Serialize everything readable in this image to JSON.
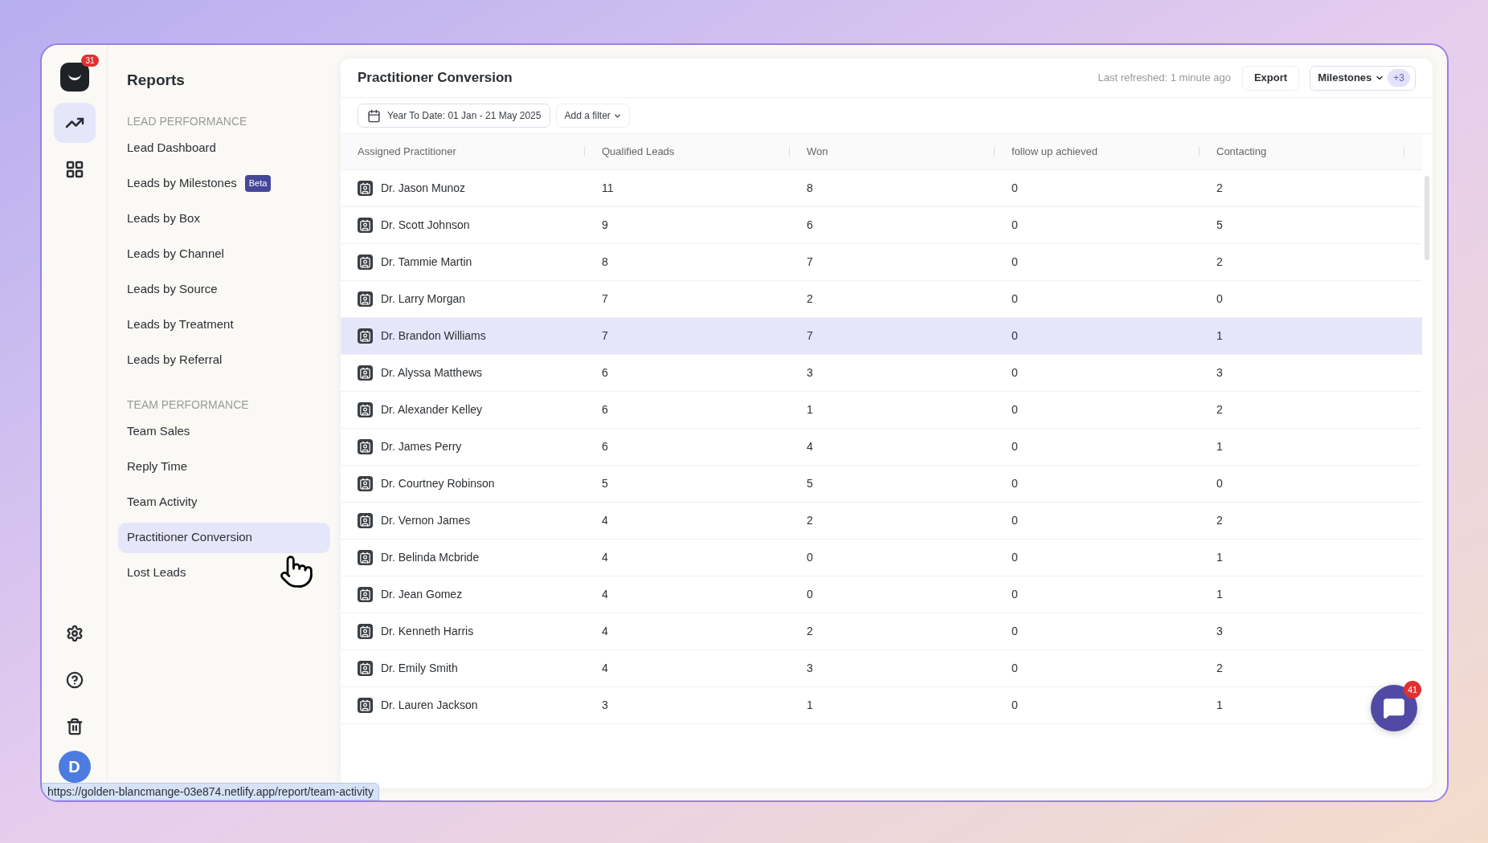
{
  "app_badge": "31",
  "rail": [
    {
      "kind": "chart",
      "selected": true
    },
    {
      "kind": "apps",
      "selected": false
    }
  ],
  "rail_bottom": [
    {
      "kind": "settings"
    },
    {
      "kind": "help"
    },
    {
      "kind": "trash"
    }
  ],
  "avatar": "D",
  "sidebar": {
    "title": "Reports",
    "sections": [
      {
        "heading": "LEAD PERFORMANCE",
        "items": [
          {
            "label": "Lead Dashboard",
            "selected": false
          },
          {
            "label": "Leads by Milestones",
            "selected": false,
            "badge": "Beta"
          },
          {
            "label": "Leads by Box",
            "selected": false
          },
          {
            "label": "Leads by Channel",
            "selected": false
          },
          {
            "label": "Leads by Source",
            "selected": false
          },
          {
            "label": "Leads by Treatment",
            "selected": false
          },
          {
            "label": "Leads by Referral",
            "selected": false
          }
        ]
      },
      {
        "heading": "TEAM PERFORMANCE",
        "items": [
          {
            "label": "Team Sales",
            "selected": false
          },
          {
            "label": "Reply Time",
            "selected": false
          },
          {
            "label": "Team Activity",
            "selected": false
          },
          {
            "label": "Practitioner Conversion",
            "selected": true
          },
          {
            "label": "Lost Leads",
            "selected": false
          }
        ]
      }
    ]
  },
  "header": {
    "title": "Practitioner Conversion",
    "last_refreshed": "Last refreshed: 1 minute ago",
    "export": "Export",
    "milestones": "Milestones",
    "milestones_count": "+3"
  },
  "filters": {
    "date_range": "Year To Date: 01 Jan - 21 May 2025",
    "add_filter": "Add a filter"
  },
  "table": {
    "columns": [
      "Assigned Practitioner",
      "Qualified Leads",
      "Won",
      "follow up achieved",
      "Contacting"
    ],
    "rows": [
      {
        "cells": [
          "Dr. Jason Munoz",
          "11",
          "8",
          "0",
          "2"
        ],
        "selected": false
      },
      {
        "cells": [
          "Dr. Scott Johnson",
          "9",
          "6",
          "0",
          "5"
        ],
        "selected": false
      },
      {
        "cells": [
          "Dr. Tammie Martin",
          "8",
          "7",
          "0",
          "2"
        ],
        "selected": false
      },
      {
        "cells": [
          "Dr. Larry Morgan",
          "7",
          "2",
          "0",
          "0"
        ],
        "selected": false
      },
      {
        "cells": [
          "Dr. Brandon Williams",
          "7",
          "7",
          "0",
          "1"
        ],
        "selected": true
      },
      {
        "cells": [
          "Dr. Alyssa Matthews",
          "6",
          "3",
          "0",
          "3"
        ],
        "selected": false
      },
      {
        "cells": [
          "Dr. Alexander Kelley",
          "6",
          "1",
          "0",
          "2"
        ],
        "selected": false
      },
      {
        "cells": [
          "Dr. James Perry",
          "6",
          "4",
          "0",
          "1"
        ],
        "selected": false
      },
      {
        "cells": [
          "Dr. Courtney Robinson",
          "5",
          "5",
          "0",
          "0"
        ],
        "selected": false
      },
      {
        "cells": [
          "Dr. Vernon James",
          "4",
          "2",
          "0",
          "2"
        ],
        "selected": false
      },
      {
        "cells": [
          "Dr. Belinda Mcbride",
          "4",
          "0",
          "0",
          "1"
        ],
        "selected": false
      },
      {
        "cells": [
          "Dr. Jean Gomez",
          "4",
          "0",
          "0",
          "1"
        ],
        "selected": false
      },
      {
        "cells": [
          "Dr. Kenneth Harris",
          "4",
          "2",
          "0",
          "3"
        ],
        "selected": false
      },
      {
        "cells": [
          "Dr. Emily Smith",
          "4",
          "3",
          "0",
          "2"
        ],
        "selected": false
      },
      {
        "cells": [
          "Dr. Lauren Jackson",
          "3",
          "1",
          "0",
          "1"
        ],
        "selected": false
      }
    ]
  },
  "chat_badge": "41",
  "status_url": "https://golden-blancmange-03e874.netlify.app/report/team-activity"
}
